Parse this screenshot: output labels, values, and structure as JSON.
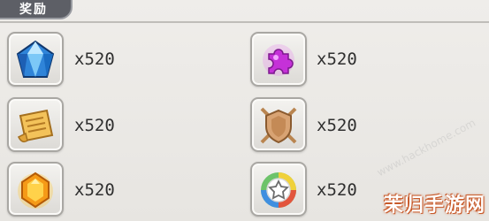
{
  "header": {
    "title": "奖励"
  },
  "rewards": [
    {
      "icon": "blue-diamond-icon",
      "quantity": "x520"
    },
    {
      "icon": "purple-puzzle-piece-icon",
      "quantity": "x520"
    },
    {
      "icon": "scroll-icon",
      "quantity": "x520"
    },
    {
      "icon": "shield-swords-icon",
      "quantity": "x520"
    },
    {
      "icon": "orange-gem-icon",
      "quantity": "x520"
    },
    {
      "icon": "rainbow-badge-icon",
      "quantity": "x520"
    }
  ],
  "watermark": {
    "text": "茉归手游网",
    "site": "www.hackhome.com"
  },
  "colors": {
    "header": "#5d5f66",
    "slot_border": "#a9a7a3",
    "background": "#eceae6"
  }
}
